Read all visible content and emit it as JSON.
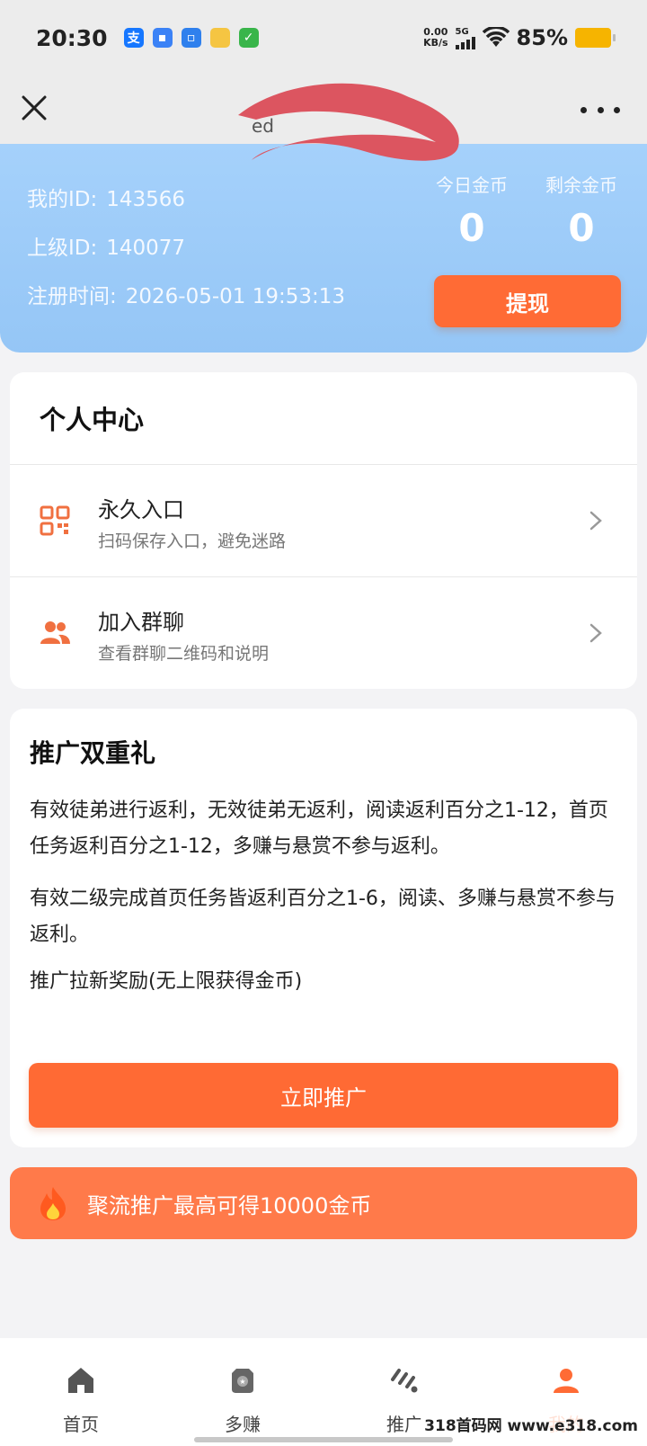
{
  "status_bar": {
    "time": "20:30",
    "speed_value": "0.00",
    "speed_unit": "KB/s",
    "network": "5G",
    "battery": "85%"
  },
  "nav": {
    "title": "ed"
  },
  "user": {
    "id_label": "我的ID:",
    "id_value": "143566",
    "parent_id_label": "上级ID:",
    "parent_id_value": "140077",
    "register_label": "注册时间:",
    "register_value": "2026-05-01 19:53:13",
    "today_coins_label": "今日金币",
    "today_coins_value": "0",
    "remaining_coins_label": "剩余金币",
    "remaining_coins_value": "0",
    "withdraw_label": "提现"
  },
  "personal_center": {
    "title": "个人中心",
    "items": [
      {
        "title": "永久入口",
        "subtitle": "扫码保存入口，避免迷路",
        "icon": "qr-code-icon"
      },
      {
        "title": "加入群聊",
        "subtitle": "查看群聊二维码和说明",
        "icon": "group-icon"
      }
    ]
  },
  "promo": {
    "title": "推广双重礼",
    "paragraph_1": "有效徒弟进行返利，无效徒弟无返利，阅读返利百分之1-12，首页任务返利百分之1-12，多赚与悬赏不参与返利。",
    "paragraph_2": "有效二级完成首页任务皆返利百分之1-6，阅读、多赚与悬赏不参与返利。",
    "paragraph_3": "推广拉新奖励(无上限获得金币)",
    "button_label": "立即推广"
  },
  "banner": {
    "text": "聚流推广最高可得10000金币",
    "icon": "fire-icon"
  },
  "tabs": [
    {
      "label": "首页",
      "icon": "home-icon"
    },
    {
      "label": "多赚",
      "icon": "earn-icon"
    },
    {
      "label": "推广",
      "icon": "promote-icon"
    },
    {
      "label": "我的",
      "icon": "profile-icon",
      "active": true
    }
  ],
  "watermark": "318首码网 www.e318.com",
  "colors": {
    "accent": "#ff6b35",
    "header_blue": "#9ccbf8"
  }
}
